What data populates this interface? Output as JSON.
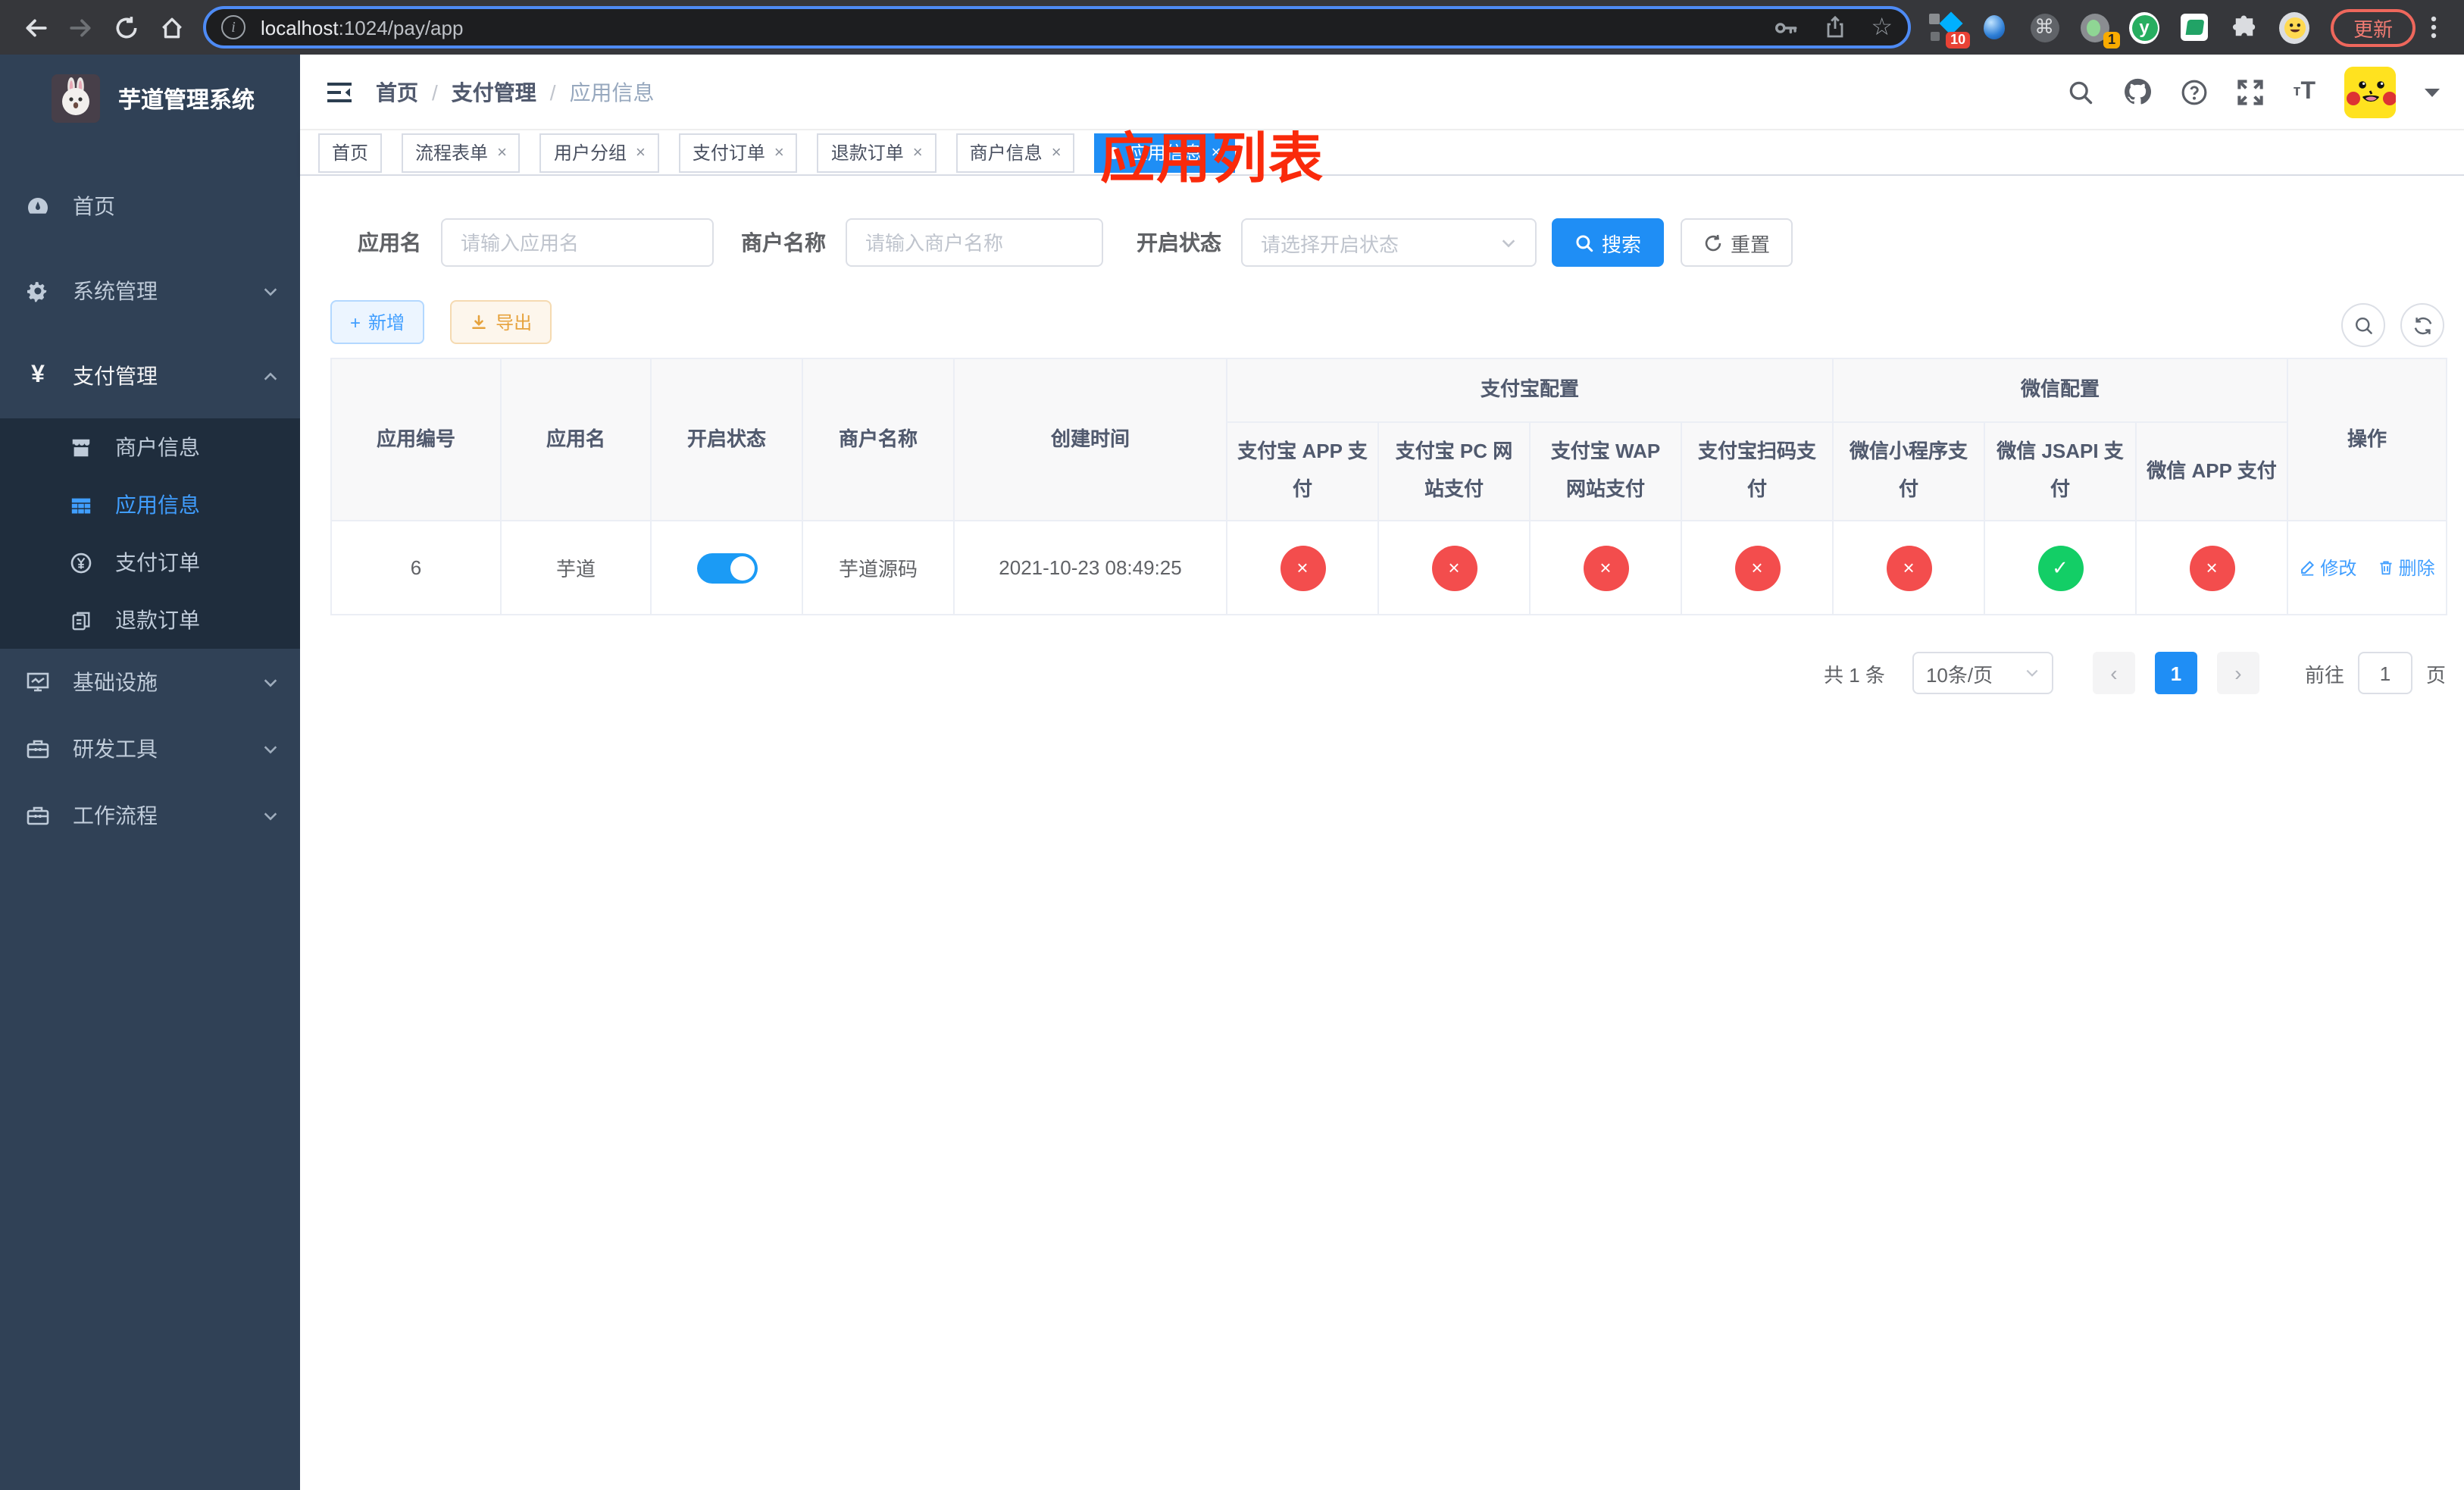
{
  "browser": {
    "url_host": "localhost",
    "url_rest": ":1024/pay/app",
    "update_button": "更新",
    "ext_badge_10": "10",
    "ext_badge_1": "1",
    "ext_y_label": "y"
  },
  "icons": {
    "separator": "/",
    "close": "×",
    "check": "✓",
    "cross": "×",
    "prev": "‹",
    "next": "›",
    "cmd": "⌘",
    "star": "☆",
    "info": "i",
    "font_small": "т",
    "font_large": "T",
    "plus": "+",
    "question": "?"
  },
  "annotation": {
    "title": "应用列表"
  },
  "sidebar": {
    "title": "芋道管理系统",
    "items": [
      {
        "label": "首页"
      },
      {
        "label": "系统管理"
      },
      {
        "label": "支付管理"
      },
      {
        "label": "商户信息"
      },
      {
        "label": "应用信息"
      },
      {
        "label": "支付订单"
      },
      {
        "label": "退款订单"
      },
      {
        "label": "基础设施"
      },
      {
        "label": "研发工具"
      },
      {
        "label": "工作流程"
      }
    ]
  },
  "breadcrumb": {
    "items": [
      "首页",
      "支付管理",
      "应用信息"
    ]
  },
  "tabs": [
    {
      "label": "首页"
    },
    {
      "label": "流程表单"
    },
    {
      "label": "用户分组"
    },
    {
      "label": "支付订单"
    },
    {
      "label": "退款订单"
    },
    {
      "label": "商户信息"
    },
    {
      "label": "应用信息"
    }
  ],
  "filters": {
    "app_name_label": "应用名",
    "app_name_placeholder": "请输入应用名",
    "merchant_label": "商户名称",
    "merchant_placeholder": "请输入商户名称",
    "status_label": "开启状态",
    "status_placeholder": "请选择开启状态",
    "search_button": "搜索",
    "reset_button": "重置"
  },
  "toolbar": {
    "add_button": "新增",
    "export_button": "导出"
  },
  "table": {
    "columns": [
      "应用编号",
      "应用名",
      "开启状态",
      "商户名称",
      "创建时间"
    ],
    "groups": [
      {
        "label": "支付宝配置"
      },
      {
        "label": "微信配置"
      }
    ],
    "sub_columns": [
      "支付宝 APP 支付",
      "支付宝 PC 网站支付",
      "支付宝 WAP 网站支付",
      "支付宝扫码支付",
      "微信小程序支付",
      "微信 JSAPI 支付",
      "微信 APP 支付"
    ],
    "actions_column": "操作",
    "row": {
      "id": "6",
      "name": "芋道",
      "enabled": true,
      "merchant": "芋道源码",
      "created": "2021-10-23 08:49:25",
      "statuses": [
        false,
        false,
        false,
        false,
        false,
        true,
        false
      ],
      "edit": "修改",
      "delete": "删除"
    }
  },
  "pagination": {
    "total": "共 1 条",
    "page_size": "10条/页",
    "page": "1",
    "goto_label": "前往",
    "goto_value": "1",
    "page_unit": "页"
  }
}
